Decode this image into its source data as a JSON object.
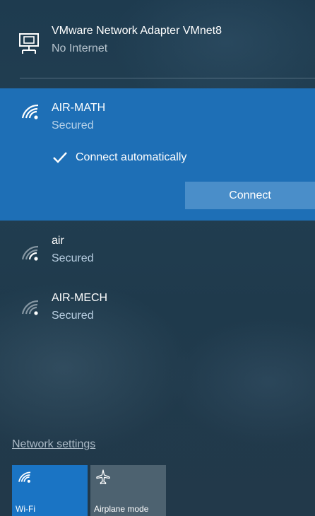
{
  "networks": {
    "ethernet": {
      "icon": "ethernet-adapter-icon",
      "name": "VMware Network Adapter VMnet8",
      "status": "No Internet"
    },
    "selected": {
      "icon": "wifi-signal-icon",
      "name": "AIR-MATH",
      "status": "Secured",
      "connect_automatically_label": "Connect automatically",
      "connect_automatically_checked": true,
      "connect_button_label": "Connect"
    },
    "list": [
      {
        "icon": "wifi-signal-icon",
        "name": "air",
        "status": "Secured"
      },
      {
        "icon": "wifi-signal-icon",
        "name": "AIR-MECH",
        "status": "Secured"
      }
    ]
  },
  "footer": {
    "settings_link": "Network settings",
    "tiles": [
      {
        "icon": "wifi-icon",
        "label": "Wi-Fi",
        "active": true
      },
      {
        "icon": "airplane-icon",
        "label": "Airplane mode",
        "active": false
      }
    ]
  },
  "colors": {
    "accent": "#1e6fb6",
    "connect_button": "#4a8ec9",
    "tile_active": "#1a74c4",
    "tile_inactive": "#4d6270"
  }
}
